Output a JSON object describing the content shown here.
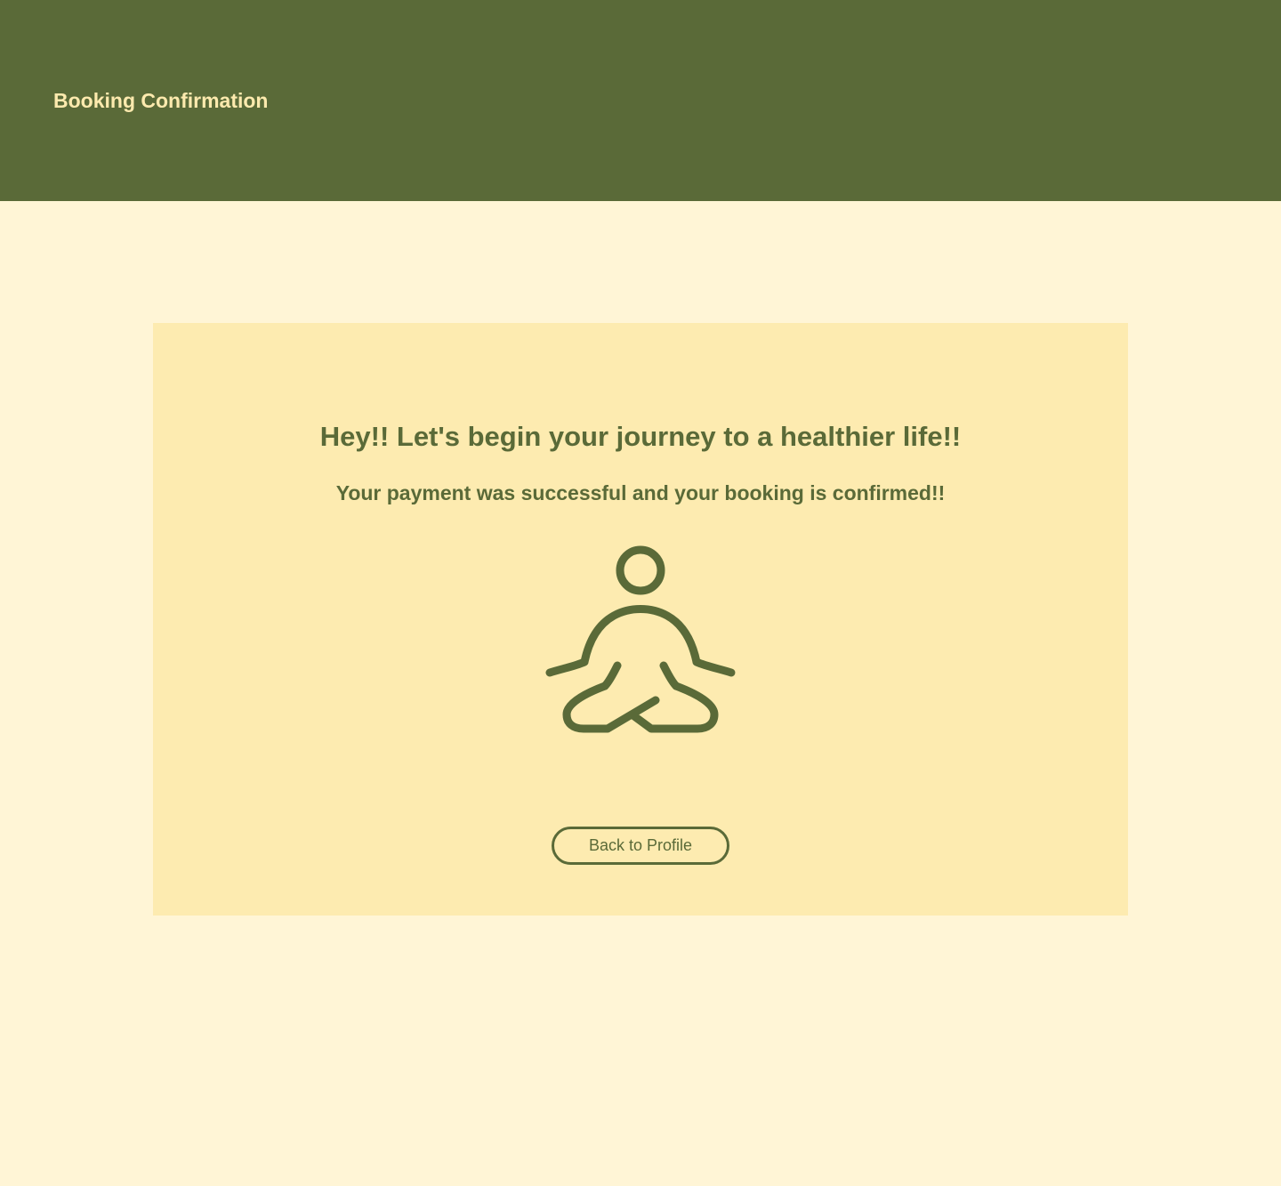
{
  "header": {
    "title": "Booking Confirmation"
  },
  "confirmation": {
    "heading": "Hey!! Let's begin your journey to a healthier life!!",
    "message": "Your payment was successful and your booking is confirmed!!",
    "illustration_icon": "meditation-icon",
    "back_button_label": "Back to Profile"
  },
  "colors": {
    "header_background": "#5A6A38",
    "header_text": "#FDEAAE",
    "page_background": "#FFF5D6",
    "card_background": "#FDEBB0",
    "accent": "#5A6A38"
  }
}
